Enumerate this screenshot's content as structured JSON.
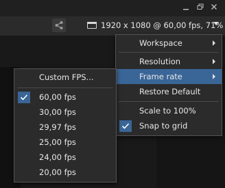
{
  "window": {
    "minimize_icon": "minimize-icon",
    "restore_icon": "restore-icon",
    "close_icon": "close-icon"
  },
  "toolbar": {
    "share_icon": "share-icon",
    "monitor_icon": "monitor-icon",
    "resolution_label": "1920 x 1080 @ 60,00 fps, 71%",
    "dropdown_icon": "chevron-down-icon"
  },
  "main_menu": {
    "items": [
      {
        "label": "Workspace",
        "submenu": true
      },
      {
        "label": "Resolution",
        "submenu": true
      },
      {
        "label": "Frame rate",
        "submenu": true,
        "highlighted": true
      },
      {
        "label": "Restore Default"
      },
      {
        "label": "Scale to 100%"
      },
      {
        "label": "Snap to grid",
        "checked": true
      }
    ]
  },
  "frame_rate_menu": {
    "items": [
      {
        "label": "Custom FPS..."
      },
      {
        "label": "60,00 fps",
        "checked": true
      },
      {
        "label": "30,00 fps"
      },
      {
        "label": "29,97 fps"
      },
      {
        "label": "25,00 fps"
      },
      {
        "label": "24,00 fps"
      },
      {
        "label": "20,00 fps"
      }
    ]
  },
  "colors": {
    "highlight": "#3a6597",
    "menu_bg": "#2b2b2b",
    "menu_border": "#545454"
  }
}
